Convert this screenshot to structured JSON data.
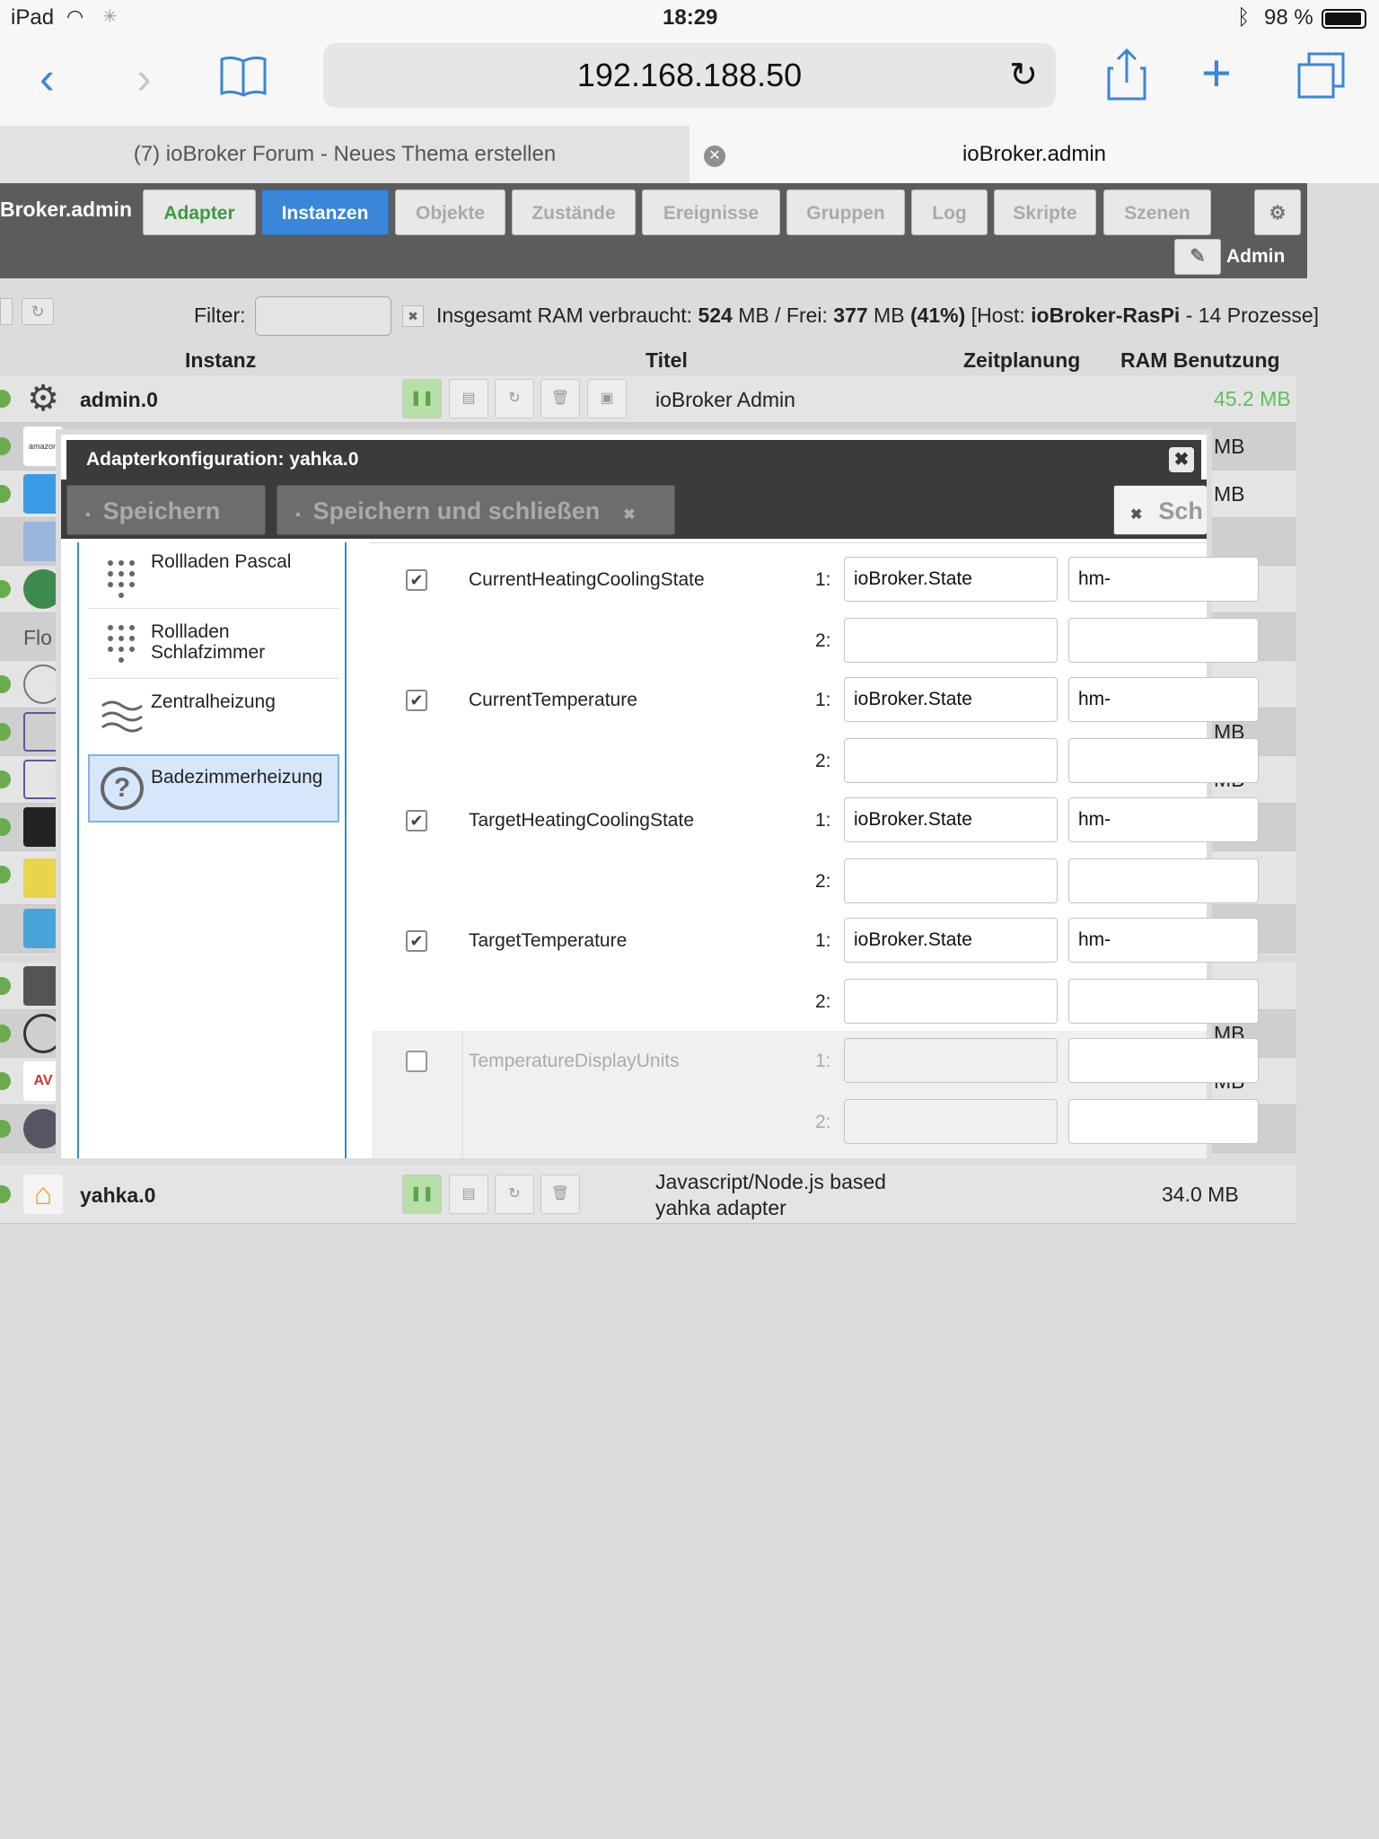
{
  "statusbar": {
    "device": "iPad",
    "time": "18:29",
    "battery": "98 %"
  },
  "browser": {
    "url": "192.168.188.50"
  },
  "tabs": [
    {
      "label": "(7) ioBroker Forum - Neues Thema erstellen"
    },
    {
      "label": "ioBroker.admin"
    }
  ],
  "app": {
    "brand": "Broker.admin",
    "nav": [
      "Adapter",
      "Instanzen",
      "Objekte",
      "Zustände",
      "Ereignisse",
      "Gruppen",
      "Log",
      "Skripte",
      "Szenen"
    ],
    "user": "Admin"
  },
  "toolbar": {
    "filter_label": "Filter:",
    "ram_prefix": "Insgesamt RAM verbraucht: ",
    "ram_used": "524",
    "ram_mid1": " MB / Frei: ",
    "ram_free": "377",
    "ram_mid2": " MB ",
    "ram_pct": "(41%)",
    "host_prefix": " [Host: ",
    "host": "ioBroker-RasPi",
    "host_suffix": " - 14 Prozesse]"
  },
  "table": {
    "headers": {
      "instance": "Instanz",
      "title": "Titel",
      "schedule": "Zeitplanung",
      "ram": "RAM Benutzung"
    },
    "first_row": {
      "name": "admin.0",
      "title": "ioBroker Admin",
      "ram": "45.2 MB"
    },
    "last_row": {
      "name": "yahka.0",
      "title_line1": "Javascript/Node.js based",
      "title_line2": "yahka adapter",
      "ram": "34.0 MB"
    },
    "mb_label": "MB",
    "flow_partial": "Flo"
  },
  "dialog": {
    "title": "Adapterkonfiguration: yahka.0",
    "save": "Speichern",
    "save_close": "Speichern und schließen",
    "close_partial": "Sch",
    "devices": [
      "Rollladen Pascal",
      "Rollladen Schlafzimmer",
      "Zentralheizung",
      "Badezimmerheizung"
    ],
    "characteristics": [
      {
        "name": "CurrentHeatingCoolingState",
        "checked": true,
        "v1": "ioBroker.State",
        "v1b": "hm-"
      },
      {
        "name": "CurrentTemperature",
        "checked": true,
        "v1": "ioBroker.State",
        "v1b": "hm-"
      },
      {
        "name": "TargetHeatingCoolingState",
        "checked": true,
        "v1": "ioBroker.State",
        "v1b": "hm-"
      },
      {
        "name": "TargetTemperature",
        "checked": true,
        "v1": "ioBroker.State",
        "v1b": "hm-"
      },
      {
        "name": "TemperatureDisplayUnits",
        "checked": false,
        "v1": "",
        "v1b": ""
      }
    ],
    "idx1": "1:",
    "idx2": "2:"
  },
  "colors": {
    "active_tab": "#3a86d8",
    "adapter_green": "#3f9a3f",
    "ram_green": "#5cc15c",
    "dialog_dark": "#3b3b3b"
  }
}
